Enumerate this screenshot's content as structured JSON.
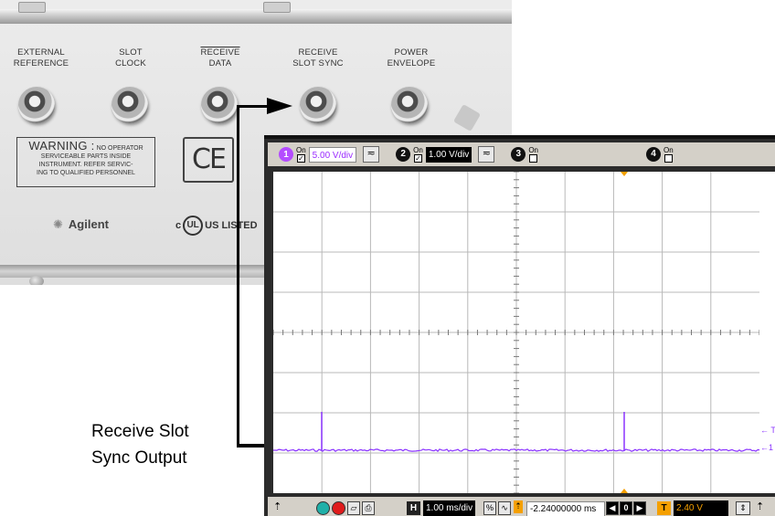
{
  "rear_panel": {
    "connectors": [
      {
        "line1": "EXTERNAL",
        "line2": "REFERENCE",
        "overline": false
      },
      {
        "line1": "SLOT",
        "line2": "CLOCK",
        "overline": false
      },
      {
        "line1": "RECEIVE",
        "line2": "DATA",
        "overline": true
      },
      {
        "line1": "RECEIVE",
        "line2": "SLOT SYNC",
        "overline": false
      },
      {
        "line1": "POWER",
        "line2": "ENVELOPE",
        "overline": false
      }
    ],
    "warning_title": "WARNING :",
    "warning_text1": "NO OPERATOR",
    "warning_text2": "SERVICEABLE PARTS INSIDE",
    "warning_text3": "INSTRUMENT. REFER SERVIC-",
    "warning_text4": "ING TO QUALIFIED PERSONNEL",
    "ce_mark": "CE",
    "brand": "Agilent",
    "ul_c": "c",
    "ul_us": "US LISTED",
    "ul_symbol": "UL"
  },
  "callout": {
    "line1": "Receive Slot",
    "line2": "Sync Output"
  },
  "scope": {
    "channels": [
      {
        "num": "1",
        "on_label": "On",
        "checked": true,
        "scale": "5.00 V/div",
        "color": "#b44cff",
        "label_color": "#ffffff"
      },
      {
        "num": "2",
        "on_label": "On",
        "checked": true,
        "scale": "1.00 V/div",
        "color": "#111111",
        "label_color": "#ffffff"
      },
      {
        "num": "3",
        "on_label": "On",
        "checked": false,
        "color": "#111111"
      },
      {
        "num": "4",
        "on_label": "On",
        "checked": false,
        "color": "#111111"
      }
    ],
    "coupling_symbol": "≂",
    "trace_color": "#8a33ff",
    "marker_color": "#f5a000",
    "right_marker_t": "← T",
    "right_marker_1": "←1",
    "bottom": {
      "h_label": "H",
      "timebase": "1.00 ms/div",
      "delay": "-2.24000000 ms",
      "delay_zero": "0",
      "t_label": "T",
      "trigger_level": "2.40 V",
      "pct": "%",
      "tilde": "∿"
    }
  }
}
